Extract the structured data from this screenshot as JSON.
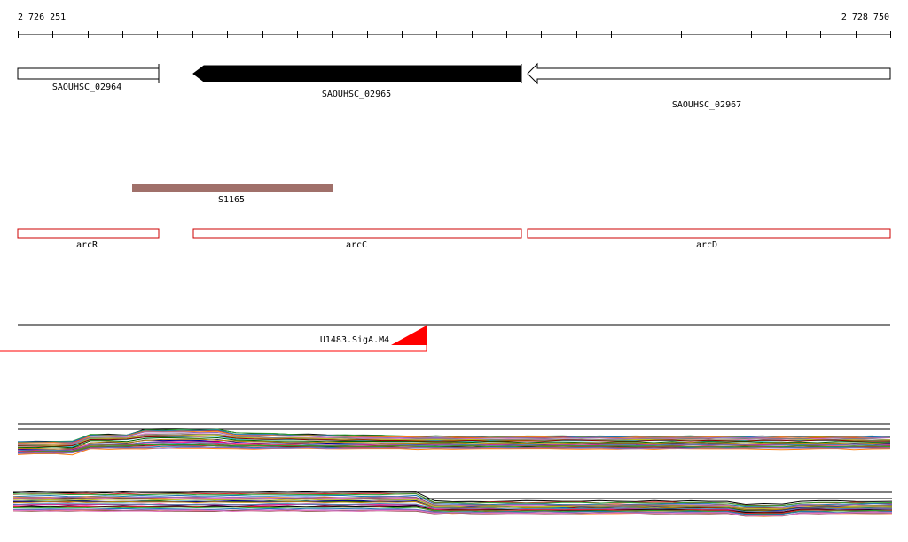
{
  "ruler": {
    "start_label": "2 726 251",
    "end_label": "2 728 750",
    "start": 2726251,
    "end": 2728750
  },
  "genes": [
    {
      "name": "SAOUHSC_02964",
      "strand": "+",
      "fill": "#ffffff"
    },
    {
      "name": "SAOUHSC_02965",
      "strand": "-",
      "fill": "#000000"
    },
    {
      "name": "SAOUHSC_02967",
      "strand": "-",
      "fill": "#ffffff"
    }
  ],
  "srna": {
    "name": "S1165",
    "color": "#a0706a"
  },
  "operon_genes": [
    {
      "name": "arcR",
      "color": "#cc0000"
    },
    {
      "name": "arcC",
      "color": "#cc0000"
    },
    {
      "name": "arcD",
      "color": "#cc0000"
    }
  ],
  "promoter": {
    "name": "U1483.SigA.M4",
    "color": "#ff0000"
  },
  "colors": {
    "accent_red": "#cc0000",
    "srna_brown": "#a0706a",
    "promoter_red": "#ff0000"
  }
}
